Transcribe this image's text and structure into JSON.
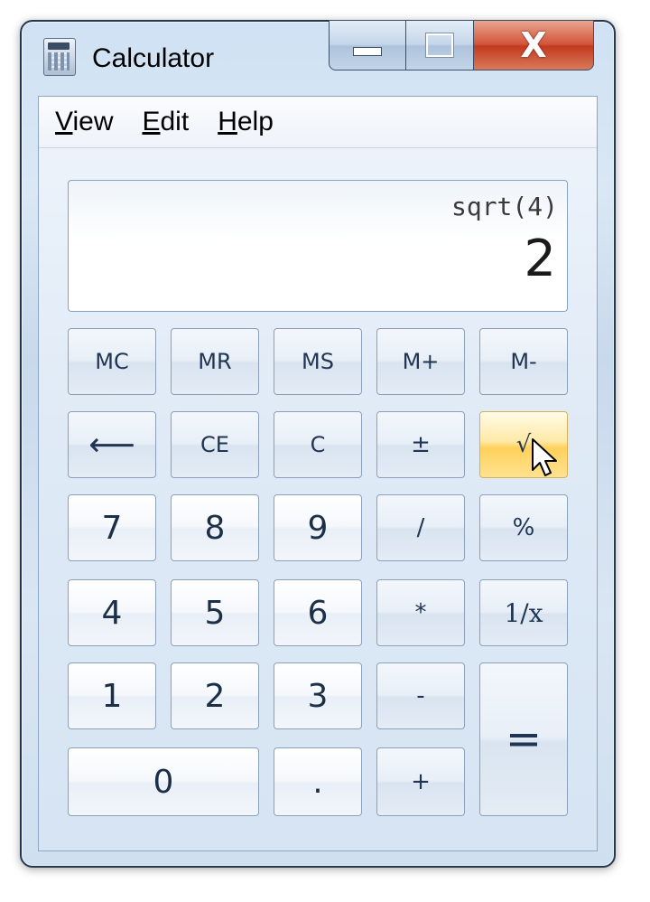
{
  "window": {
    "title": "Calculator",
    "minimize_icon": "minimize-icon",
    "maximize_icon": "maximize-icon",
    "close_icon": "close-icon",
    "close_label": "X"
  },
  "menu": {
    "items": [
      {
        "label": "View",
        "access_key": "V"
      },
      {
        "label": "Edit",
        "access_key": "E"
      },
      {
        "label": "Help",
        "access_key": "H"
      }
    ]
  },
  "display": {
    "expression": "sqrt(4)",
    "result": "2"
  },
  "keys": {
    "mc": "MC",
    "mr": "MR",
    "ms": "MS",
    "m_plus": "M+",
    "m_minus": "M-",
    "backspace": "⟵",
    "ce": "CE",
    "c": "C",
    "negate": "±",
    "sqrt": "√",
    "seven": "7",
    "eight": "8",
    "nine": "9",
    "divide": "/",
    "percent": "%",
    "four": "4",
    "five": "5",
    "six": "6",
    "multiply": "*",
    "reciprocal": "1/x",
    "one": "1",
    "two": "2",
    "three": "3",
    "subtract": "-",
    "zero": "0",
    "decimal": ".",
    "add": "+",
    "equals": "="
  },
  "state": {
    "hovered_key": "sqrt"
  },
  "colors": {
    "hover_highlight": "#ffd15c",
    "close_button": "#c23a1f",
    "frame": "#26384f"
  }
}
